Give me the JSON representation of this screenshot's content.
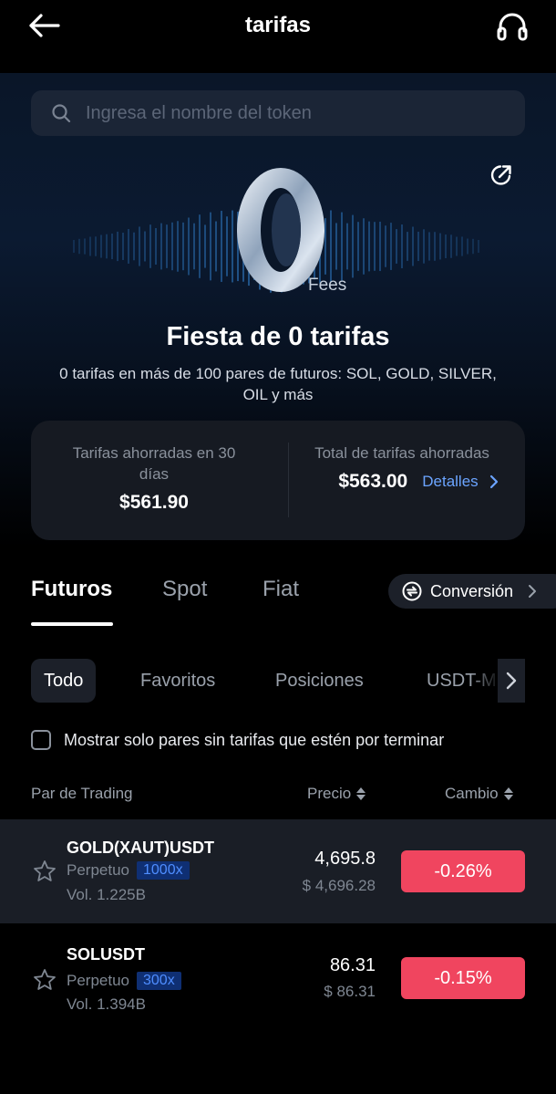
{
  "header": {
    "title": "tarifas",
    "back_icon": "arrow-left-icon",
    "support_icon": "headset-icon"
  },
  "search": {
    "placeholder": "Ingresa el nombre del token"
  },
  "hero": {
    "logo_text": "Fees",
    "title": "Fiesta de 0 tarifas",
    "subtitle": "0 tarifas en más de 100 pares de futuros: SOL, GOLD, SILVER, OIL y más"
  },
  "stats": {
    "saved_30d_label": "Tarifas ahorradas en 30 días",
    "saved_30d_value": "$561.90",
    "total_label": "Total de tarifas ahorradas",
    "total_value": "$563.00",
    "details_label": "Detalles"
  },
  "tabs": [
    {
      "label": "Futuros",
      "active": true
    },
    {
      "label": "Spot",
      "active": false
    },
    {
      "label": "Fiat",
      "active": false
    }
  ],
  "conversion": {
    "label": "Conversión"
  },
  "filters": [
    {
      "label": "Todo",
      "active": true
    },
    {
      "label": "Favoritos",
      "active": false
    },
    {
      "label": "Posiciones",
      "active": false
    },
    {
      "label": "USDT-M",
      "active": false
    }
  ],
  "checkbox": {
    "label": "Mostrar solo pares sin tarifas que estén por terminar",
    "checked": false
  },
  "table": {
    "headers": {
      "pair": "Par de Trading",
      "price": "Precio",
      "change": "Cambio"
    },
    "rows": [
      {
        "symbol": "GOLD(XAUT)USDT",
        "type": "Perpetuo",
        "leverage": "1000x",
        "volume": "Vol. 1.225B",
        "price": "4,695.8",
        "price_usd": "$ 4,696.28",
        "change": "-0.26%"
      },
      {
        "symbol": "SOLUSDT",
        "type": "Perpetuo",
        "leverage": "300x",
        "volume": "Vol. 1.394B",
        "price": "86.31",
        "price_usd": "$ 86.31",
        "change": "-0.15%"
      }
    ]
  },
  "colors": {
    "negative": "#f0455f",
    "link": "#6ba4ff",
    "leverage_bg": "#0f2f73",
    "leverage_text": "#4e8dff"
  }
}
